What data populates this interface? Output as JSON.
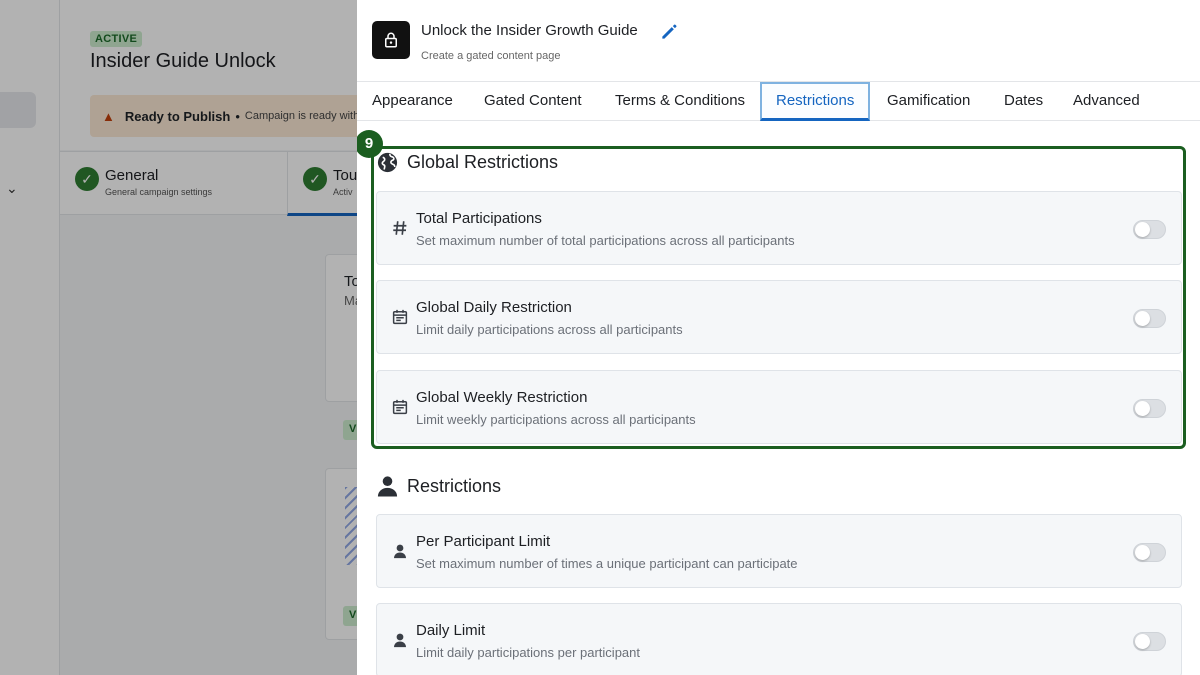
{
  "background": {
    "status_badge": "ACTIVE",
    "campaign_title": "Insider Guide Unlock",
    "banner": {
      "title": "Ready to Publish",
      "separator": "•",
      "text": "Campaign is ready with"
    },
    "steps": [
      {
        "label": "General",
        "sub": "General campaign settings"
      },
      {
        "label": "Tou",
        "sub": "Activ"
      }
    ],
    "cards": [
      {
        "title": "To",
        "sub": "Ma"
      }
    ],
    "chips": [
      "V",
      "V"
    ]
  },
  "drawer": {
    "title": "Unlock the Insider Growth Guide",
    "subtitle": "Create a gated content page",
    "tabs": [
      {
        "label": "Appearance"
      },
      {
        "label": "Gated Content"
      },
      {
        "label": "Terms & Conditions"
      },
      {
        "label": "Restrictions",
        "active": true
      },
      {
        "label": "Gamification"
      },
      {
        "label": "Dates"
      },
      {
        "label": "Advanced"
      }
    ],
    "step_number": "9",
    "global_section": {
      "title": "Global Restrictions",
      "icon": "globe-icon",
      "items": [
        {
          "icon": "hash-icon",
          "title": "Total Participations",
          "desc": "Set maximum number of total participations across all participants",
          "enabled": false
        },
        {
          "icon": "calendar-icon",
          "title": "Global Daily Restriction",
          "desc": "Limit daily participations across all participants",
          "enabled": false
        },
        {
          "icon": "calendar-icon",
          "title": "Global Weekly Restriction",
          "desc": "Limit weekly participations across all participants",
          "enabled": false
        }
      ]
    },
    "participant_section": {
      "title": "Restrictions",
      "icon": "person-icon",
      "items": [
        {
          "icon": "person-icon",
          "title": "Per Participant Limit",
          "desc": "Set maximum number of times a unique participant can participate",
          "enabled": false
        },
        {
          "icon": "person-icon",
          "title": "Daily Limit",
          "desc": "Limit daily participations per participant",
          "enabled": false
        }
      ]
    }
  },
  "colors": {
    "accent": "#1565c0",
    "highlight": "#1b5e20",
    "toggle_off": "#dcdfe3"
  }
}
